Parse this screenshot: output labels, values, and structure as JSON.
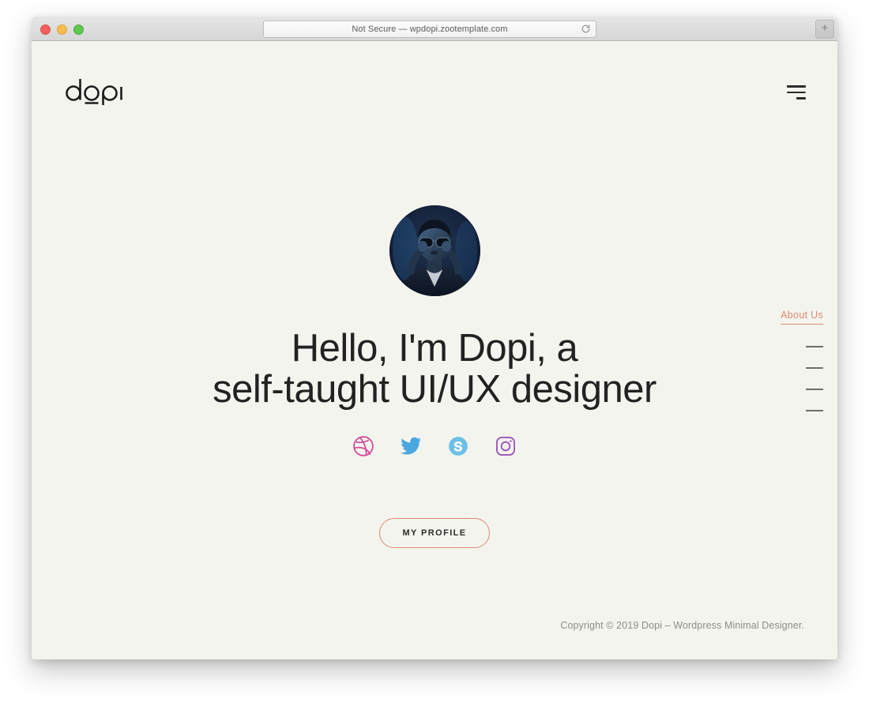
{
  "browser": {
    "url_text": "Not Secure — wpdopi.zootemplate.com",
    "reload_icon": "reload-icon",
    "newtab_label": "+",
    "traffic_lights": [
      "close",
      "minimize",
      "maximize"
    ]
  },
  "site": {
    "logo_text": "dopi",
    "menu_toggle_icon": "hamburger-icon"
  },
  "hero": {
    "avatar_alt": "portrait-photo",
    "title_line1": "Hello, I'm Dopi, a",
    "title_line2": "self-taught UI/UX designer",
    "cta_label": "MY PROFILE",
    "socials": [
      {
        "name": "dribbble",
        "icon": "dribbble-icon",
        "color": "#d1499b"
      },
      {
        "name": "twitter",
        "icon": "twitter-icon",
        "color": "#4aa7e0"
      },
      {
        "name": "skype",
        "icon": "skype-icon",
        "color": "#6cc0e5"
      },
      {
        "name": "instagram",
        "icon": "instagram-icon",
        "color": "#9b55bd"
      }
    ]
  },
  "side_nav": {
    "active_label": "About Us",
    "active_color": "#e08a72",
    "dash_count": 4,
    "dash_color": "#6f6f6a"
  },
  "footer": {
    "copyright": "Copyright © 2019 Dopi – Wordpress Minimal Designer."
  },
  "theme": {
    "page_background": "#f4f4ee",
    "text_color": "#222222",
    "accent": "#e08a72"
  }
}
